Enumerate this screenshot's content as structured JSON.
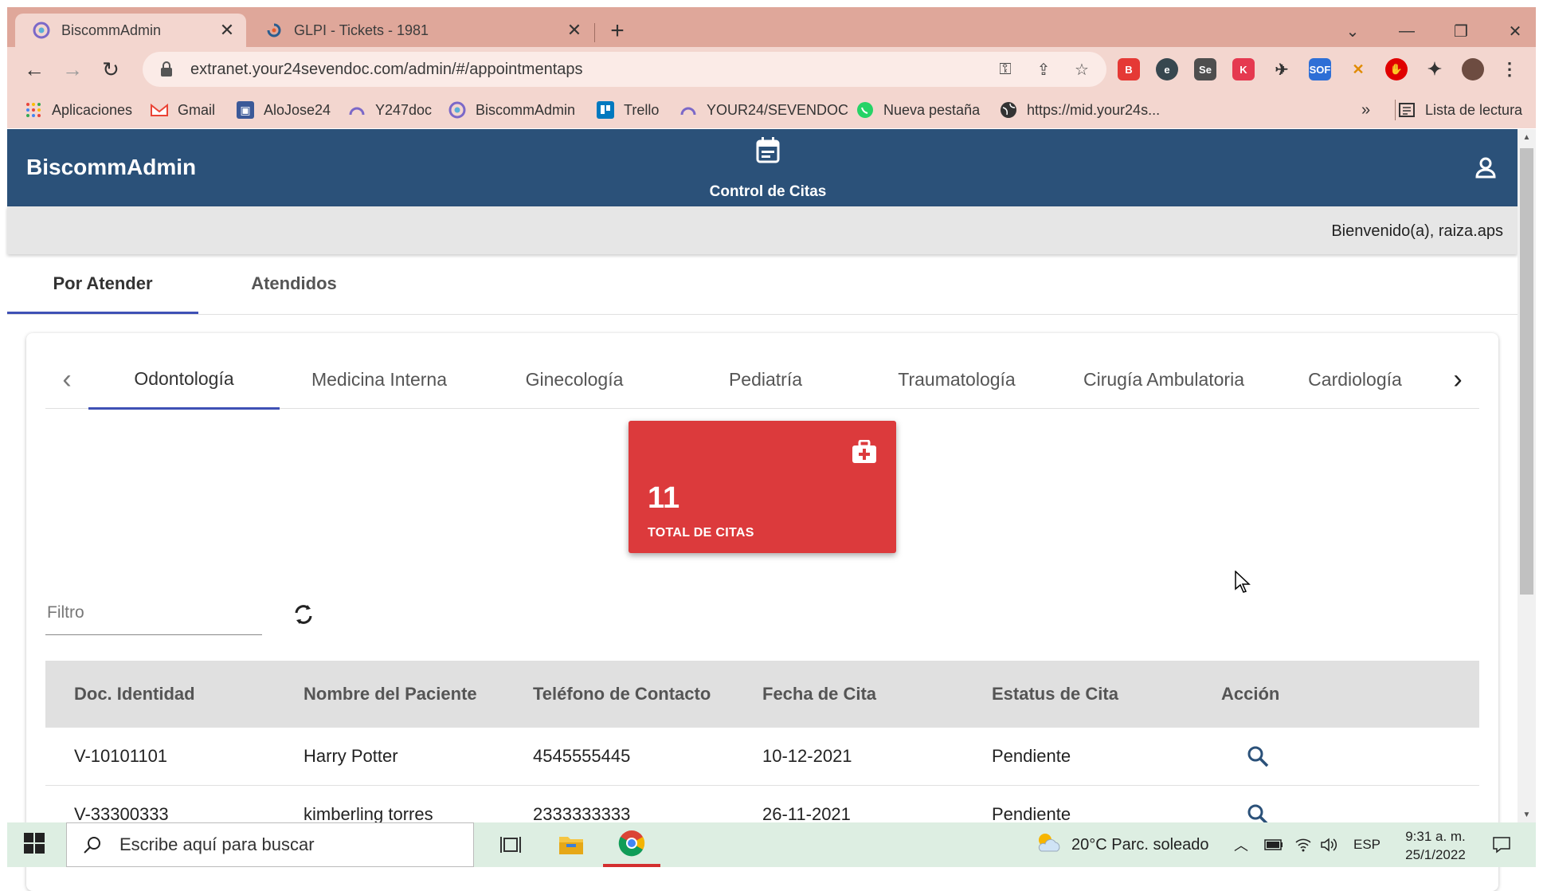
{
  "browser": {
    "tabs": [
      {
        "title": "BiscommAdmin",
        "active": true,
        "icon": "biscomm-favicon-icon"
      },
      {
        "title": "GLPI - Tickets - 1981",
        "active": false,
        "icon": "glpi-favicon-icon"
      }
    ],
    "url": "extranet.your24sevendoc.com/admin/#/appointmentaps",
    "bookmarks": [
      {
        "label": "Aplicaciones",
        "icon": "apps-grid-icon"
      },
      {
        "label": "Gmail",
        "icon": "gmail-icon"
      },
      {
        "label": "AloJose24",
        "icon": "alojose-icon"
      },
      {
        "label": "Y247doc",
        "icon": "y247doc-icon"
      },
      {
        "label": "BiscommAdmin",
        "icon": "biscomm-icon"
      },
      {
        "label": "Trello",
        "icon": "trello-icon"
      },
      {
        "label": "YOUR24/SEVENDOC",
        "icon": "your24-icon"
      },
      {
        "label": "Nueva pestaña",
        "icon": "whatsapp-icon"
      },
      {
        "label": "https://mid.your24s...",
        "icon": "globe-icon"
      }
    ],
    "bookmarks_overflow": "»",
    "reading_list": "Lista de lectura"
  },
  "app": {
    "brand": "BiscommAdmin",
    "header_title": "Control de Citas",
    "welcome": "Bienvenido(a), raiza.aps",
    "main_tabs": [
      {
        "label": "Por Atender",
        "active": true
      },
      {
        "label": "Atendidos",
        "active": false
      }
    ],
    "specialty_tabs": [
      {
        "label": "Odontología",
        "active": true
      },
      {
        "label": "Medicina Interna",
        "active": false
      },
      {
        "label": "Ginecología",
        "active": false
      },
      {
        "label": "Pediatría",
        "active": false
      },
      {
        "label": "Traumatología",
        "active": false
      },
      {
        "label": "Cirugía Ambulatoria",
        "active": false
      },
      {
        "label": "Cardiología",
        "active": false
      }
    ],
    "stat": {
      "value": "11",
      "label": "TOTAL DE CITAS",
      "color": "#dc3a3c"
    },
    "filter": {
      "placeholder": "Filtro",
      "value": ""
    },
    "table": {
      "headers": [
        "Doc. Identidad",
        "Nombre del Paciente",
        "Teléfono de Contacto",
        "Fecha de Cita",
        "Estatus de Cita",
        "Acción"
      ],
      "rows": [
        [
          "V-10101101",
          "Harry Potter",
          "4545555445",
          "10-12-2021",
          "Pendiente"
        ],
        [
          "V-33300333",
          "kimberling torres",
          "2333333333",
          "26-11-2021",
          "Pendiente"
        ]
      ]
    },
    "colors": {
      "appbar": "#2b5179",
      "accent": "#3f51b5"
    }
  },
  "taskbar": {
    "search_placeholder": "Escribe aquí para buscar",
    "weather": "20°C  Parc. soleado",
    "language": "ESP",
    "time": "9:31 a. m.",
    "date": "25/1/2022"
  }
}
